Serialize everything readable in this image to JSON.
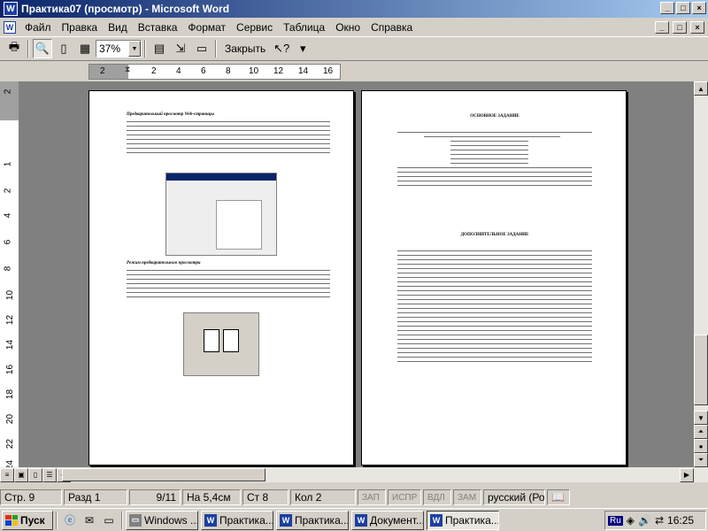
{
  "window": {
    "title": "Практика07 (просмотр) - Microsoft Word",
    "buttons": [
      "_",
      "□",
      "×"
    ]
  },
  "menu": {
    "items": [
      "Файл",
      "Правка",
      "Вид",
      "Вставка",
      "Формат",
      "Сервис",
      "Таблица",
      "Окно",
      "Справка"
    ],
    "doc_buttons": [
      "_",
      "□",
      "×"
    ]
  },
  "toolbar": {
    "zoom": "37%",
    "close_label": "Закрыть"
  },
  "ruler": {
    "top": [
      "2",
      "2",
      "4",
      "6",
      "8",
      "10",
      "12",
      "14",
      "16"
    ],
    "left": [
      "2",
      "1",
      "2",
      "4",
      "6",
      "8",
      "10",
      "12",
      "14",
      "16",
      "18",
      "20",
      "22",
      "24"
    ]
  },
  "pages": {
    "p1": {
      "heading1": "Предварительный просмотр Web-страницы",
      "heading2": "Режим предварительного просмотра"
    },
    "p2": {
      "heading1": "ОСНОВНОЕ ЗАДАНИЕ",
      "heading2": "ДОПОЛНИТЕЛЬНОЕ ЗАДАНИЕ"
    }
  },
  "status": {
    "page": "Стр. 9",
    "section": "Разд 1",
    "of": "9/11",
    "at": "На 5,4см",
    "line": "Ст 8",
    "col": "Кол 2",
    "flags": [
      "ЗАП",
      "ИСПР",
      "ВДЛ",
      "ЗАМ"
    ],
    "lang": "русский (Ро"
  },
  "taskbar": {
    "start": "Пуск",
    "tasks": [
      "Windows ...",
      "Практика...",
      "Практика...",
      "Документ...",
      "Практика..."
    ],
    "tray_lang": "Ru",
    "clock": "16:25"
  }
}
